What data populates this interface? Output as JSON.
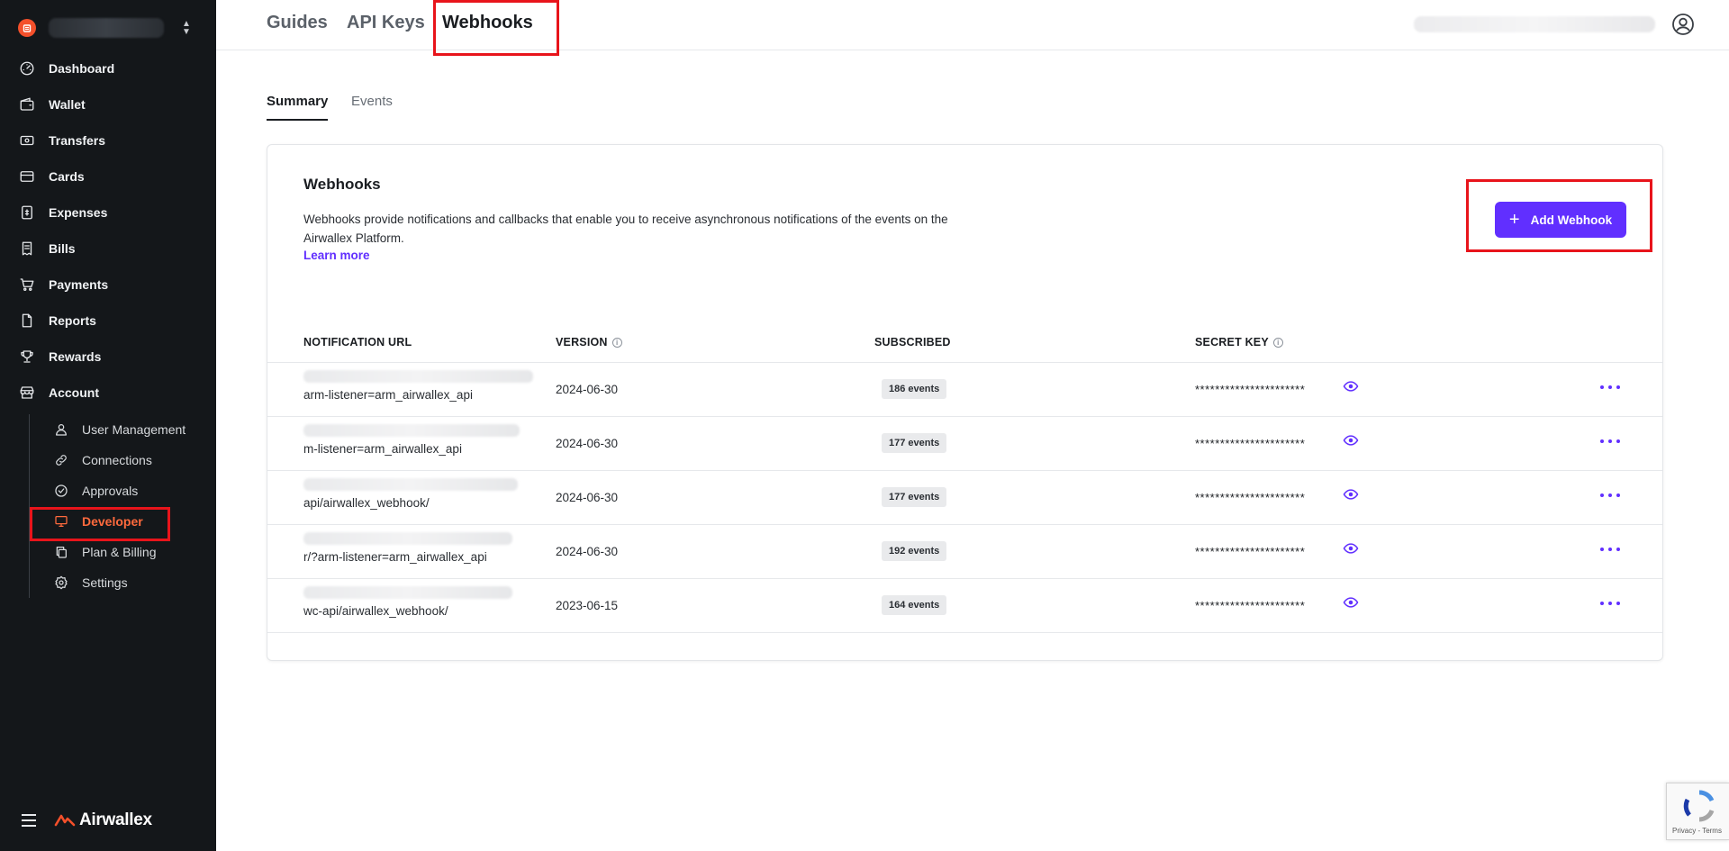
{
  "sidebar": {
    "nav": [
      {
        "label": "Dashboard",
        "icon": "dashboard-icon"
      },
      {
        "label": "Wallet",
        "icon": "wallet-icon"
      },
      {
        "label": "Transfers",
        "icon": "transfers-icon"
      },
      {
        "label": "Cards",
        "icon": "card-icon"
      },
      {
        "label": "Expenses",
        "icon": "expenses-icon"
      },
      {
        "label": "Bills",
        "icon": "bills-icon"
      },
      {
        "label": "Payments",
        "icon": "cart-icon"
      },
      {
        "label": "Reports",
        "icon": "reports-icon"
      },
      {
        "label": "Rewards",
        "icon": "trophy-icon"
      },
      {
        "label": "Account",
        "icon": "building-icon"
      }
    ],
    "account_sub": [
      {
        "label": "User Management",
        "icon": "user-icon"
      },
      {
        "label": "Connections",
        "icon": "link-icon"
      },
      {
        "label": "Approvals",
        "icon": "check-circle-icon"
      },
      {
        "label": "Developer",
        "icon": "monitor-icon",
        "active": true
      },
      {
        "label": "Plan & Billing",
        "icon": "copy-icon"
      },
      {
        "label": "Settings",
        "icon": "gear-icon"
      }
    ],
    "brand": "Airwallex"
  },
  "topbar": {
    "tabs": [
      {
        "label": "Guides"
      },
      {
        "label": "API Keys"
      },
      {
        "label": "Webhooks",
        "active": true
      }
    ]
  },
  "subtabs": [
    {
      "label": "Summary",
      "active": true
    },
    {
      "label": "Events"
    }
  ],
  "card": {
    "title": "Webhooks",
    "description": "Webhooks provide notifications and callbacks that enable you to receive asynchronous notifications of the events on the Airwallex Platform.",
    "learn_more": "Learn more",
    "add_button": "Add Webhook"
  },
  "table": {
    "headers": {
      "url": "NOTIFICATION URL",
      "version": "VERSION",
      "subscribed": "SUBSCRIBED",
      "secret": "SECRET KEY"
    },
    "rows": [
      {
        "url": "arm-listener=arm_airwallex_api",
        "version": "2024-06-30",
        "subscribed": "186 events",
        "secret": "**********************"
      },
      {
        "url": "m-listener=arm_airwallex_api",
        "version": "2024-06-30",
        "subscribed": "177 events",
        "secret": "**********************"
      },
      {
        "url": "api/airwallex_webhook/",
        "version": "2024-06-30",
        "subscribed": "177 events",
        "secret": "**********************"
      },
      {
        "url": "r/?arm-listener=arm_airwallex_api",
        "version": "2024-06-30",
        "subscribed": "192 events",
        "secret": "**********************"
      },
      {
        "url": "wc-api/airwallex_webhook/",
        "version": "2023-06-15",
        "subscribed": "164 events",
        "secret": "**********************"
      }
    ]
  },
  "recaptcha": {
    "terms": "Privacy - Terms"
  },
  "colors": {
    "accent": "#612fff",
    "brand": "#f4502b",
    "sidebar_bg": "#14171a",
    "highlight": "#e8141b"
  }
}
